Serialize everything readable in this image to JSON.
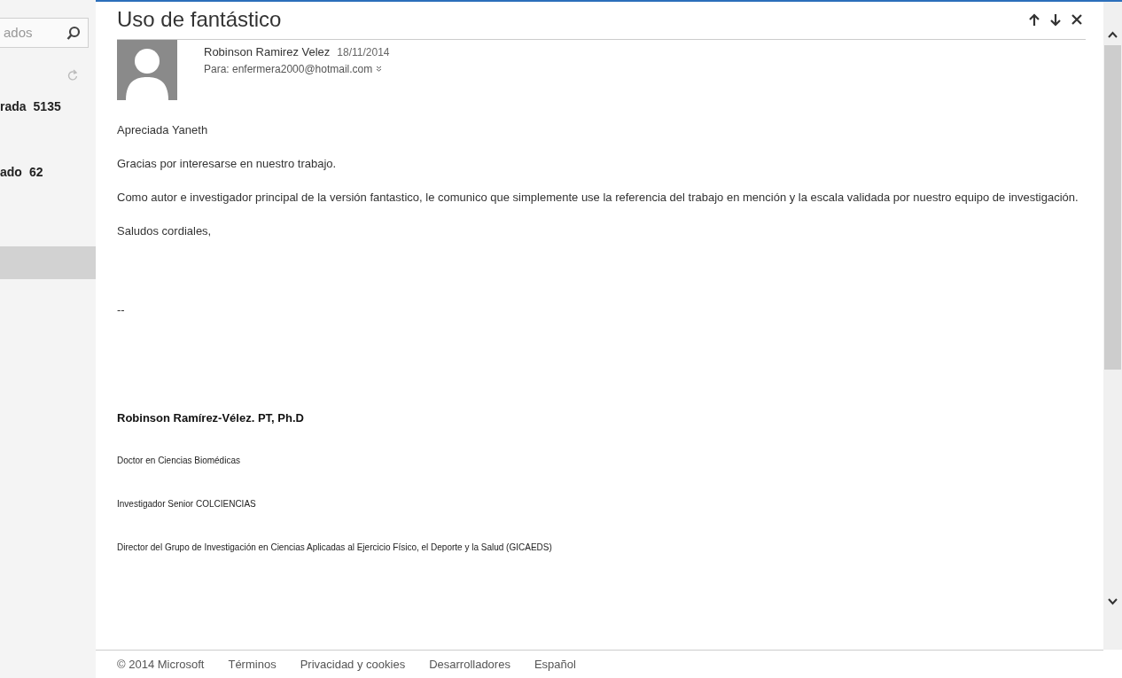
{
  "sidebar": {
    "search": {
      "value": "ados"
    },
    "folders": [
      {
        "label": "rada",
        "count": "5135",
        "selected": false
      },
      {
        "label": "ado",
        "count": "62",
        "selected": false
      }
    ]
  },
  "message": {
    "subject": "Uso de fantástico",
    "sender": "Robinson Ramirez Velez",
    "date": "18/11/2014",
    "to": "Para: enfermera2000@hotmail.com",
    "body": [
      "Apreciada Yaneth",
      "Gracias por interesarse en nuestro trabajo.",
      "Como autor e investigador principal de la versión fantastico, le comunico que simplemente use la referencia del trabajo en mención y la escala validada por nuestro equipo de investigación.",
      "Saludos cordiales,",
      "--"
    ],
    "signature": {
      "name": "Robinson Ramírez-Vélez. PT, Ph.D",
      "lines": [
        "Doctor en Ciencias Biomédicas",
        "Investigador Senior COLCIENCIAS",
        "Director del Grupo de Investigación en Ciencias Aplicadas al Ejercicio Físico, el Deporte y la Salud (GICAEDS)"
      ]
    }
  },
  "footer": [
    "© 2014 Microsoft",
    "Términos",
    "Privacidad y cookies",
    "Desarrolladores",
    "Español"
  ]
}
